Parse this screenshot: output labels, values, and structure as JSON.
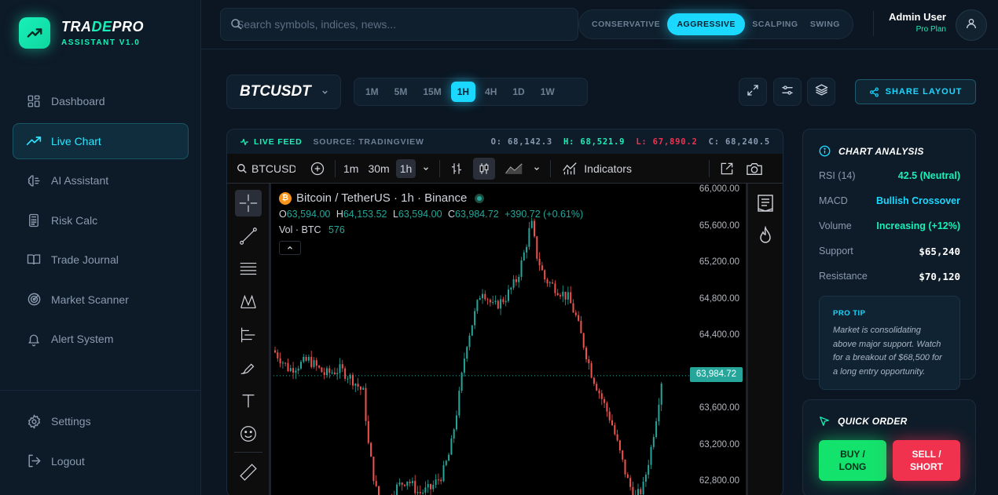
{
  "brand": {
    "title_a": "TRA",
    "title_b": "DE",
    "title_c": "PRO",
    "subtitle": "ASSISTANT V1.0"
  },
  "sidebar": {
    "items": [
      {
        "label": "Dashboard",
        "icon": "grid-icon"
      },
      {
        "label": "Live Chart",
        "icon": "trend-icon",
        "active": true
      },
      {
        "label": "AI Assistant",
        "icon": "brain-icon"
      },
      {
        "label": "Risk Calc",
        "icon": "calculator-icon"
      },
      {
        "label": "Trade Journal",
        "icon": "book-icon"
      },
      {
        "label": "Market Scanner",
        "icon": "radar-icon"
      },
      {
        "label": "Alert System",
        "icon": "bell-icon"
      }
    ],
    "bottom": [
      {
        "label": "Settings",
        "icon": "gear-icon"
      },
      {
        "label": "Logout",
        "icon": "logout-icon"
      }
    ]
  },
  "header": {
    "search_placeholder": "Search symbols, indices, news...",
    "modes": [
      "CONSERVATIVE",
      "AGGRESSIVE",
      "SCALPING",
      "SWING"
    ],
    "active_mode": "AGGRESSIVE",
    "user_name": "Admin User",
    "user_plan": "Pro Plan"
  },
  "toolbar": {
    "symbol": "BTCUSDT",
    "timeframes": [
      "1M",
      "5M",
      "15M",
      "1H",
      "4H",
      "1D",
      "1W"
    ],
    "active_timeframe": "1H",
    "share_label": "SHARE LAYOUT"
  },
  "feed": {
    "live_label": "LIVE FEED",
    "source": "SOURCE: TRADINGVIEW",
    "open": "O: 68,142.3",
    "high": "H: 68,521.9",
    "low": "L: 67,890.2",
    "close": "C: 68,240.5"
  },
  "tv": {
    "symbol": "BTCUSDT",
    "intervals": [
      "1m",
      "30m",
      "1h"
    ],
    "indicators_label": "Indicators",
    "title": "Bitcoin / TetherUS · 1h · Binance",
    "o_label": "O",
    "o_val": "63,594.00",
    "h_label": "H",
    "h_val": "64,153.52",
    "l_label": "L",
    "l_val": "63,594.00",
    "c_label": "C",
    "c_val": "63,984.72",
    "change": "+390.72 (+0.61%)",
    "vol_label": "Vol · BTC",
    "vol_val": "576",
    "price_labels": [
      "66,000.00",
      "65,600.00",
      "65,200.00",
      "64,800.00",
      "64,400.00",
      "63,600.00",
      "63,200.00",
      "62,800.00"
    ],
    "current_price": "63,984.72"
  },
  "chart_data": {
    "type": "candlestick",
    "ylim": [
      62700,
      66000
    ],
    "current": 63984.72,
    "up_color": "#26a69a",
    "down_color": "#ef5350"
  },
  "analysis": {
    "title": "CHART ANALYSIS",
    "rows": [
      {
        "k": "RSI (14)",
        "v": "42.5 (Neutral)",
        "color": "#19f0b9"
      },
      {
        "k": "MACD",
        "v": "Bullish Crossover",
        "color": "#1ad8ff"
      },
      {
        "k": "Volume",
        "v": "Increasing (+12%)",
        "color": "#19f0b9"
      },
      {
        "k": "Support",
        "v": "$65,240",
        "color": "#ffffff"
      },
      {
        "k": "Resistance",
        "v": "$70,120",
        "color": "#ffffff"
      }
    ],
    "tip_title": "PRO TIP",
    "tip_text": "Market is consolidating above major support. Watch for a breakout of $68,500 for a long entry opportunity."
  },
  "order": {
    "title": "QUICK ORDER",
    "buy": "BUY / LONG",
    "sell": "SELL / SHORT"
  }
}
